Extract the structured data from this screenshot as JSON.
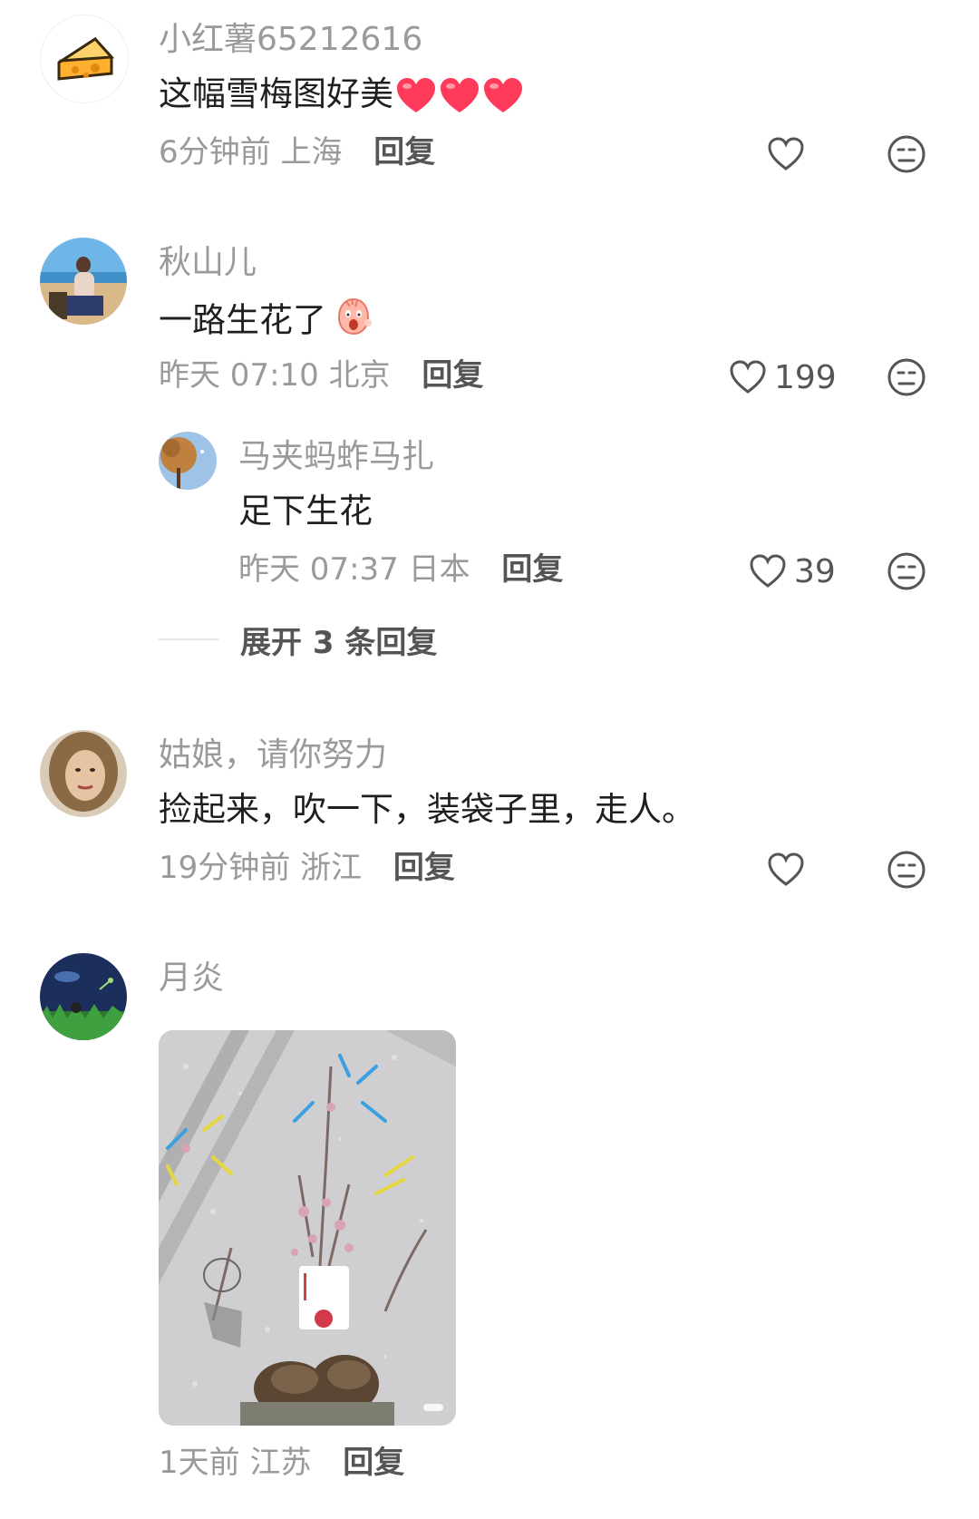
{
  "comments": [
    {
      "username": "小红薯65212616",
      "text": "这幅雪梅图好美",
      "emoji": [
        "heart-emoji",
        "heart-emoji",
        "heart-emoji"
      ],
      "time": "6分钟前",
      "location": "上海",
      "reply_label": "回复",
      "likes": ""
    },
    {
      "username": "秋山儿",
      "text": "一路生花了",
      "emoji": [
        "surprised-face-emoji"
      ],
      "time": "昨天 07:10",
      "location": "北京",
      "reply_label": "回复",
      "likes": "199"
    },
    {
      "username": "姑娘，请你努力",
      "text": "捡起来，吹一下，装袋子里，走人。",
      "time": "19分钟前",
      "location": "浙江",
      "reply_label": "回复",
      "likes": ""
    },
    {
      "username": "月炎",
      "text": "",
      "image": "snow-plum-blossom-photo",
      "time": "1天前",
      "location": "江苏",
      "reply_label": "回复",
      "likes": ""
    }
  ],
  "sub_reply": {
    "username": "马夹蚂蚱马扎",
    "text": "足下生花",
    "time": "昨天 07:37",
    "location": "日本",
    "reply_label": "回复",
    "likes": "39"
  },
  "expand_replies": "展开 3 条回复",
  "icons": {
    "like": "heart-outline-icon",
    "dislike": "neutral-face-icon"
  },
  "colors": {
    "username": "#9a9a9a",
    "text": "#1f1f1f",
    "meta": "#9a9a9a",
    "heart_emoji": "#ff3b5c"
  }
}
